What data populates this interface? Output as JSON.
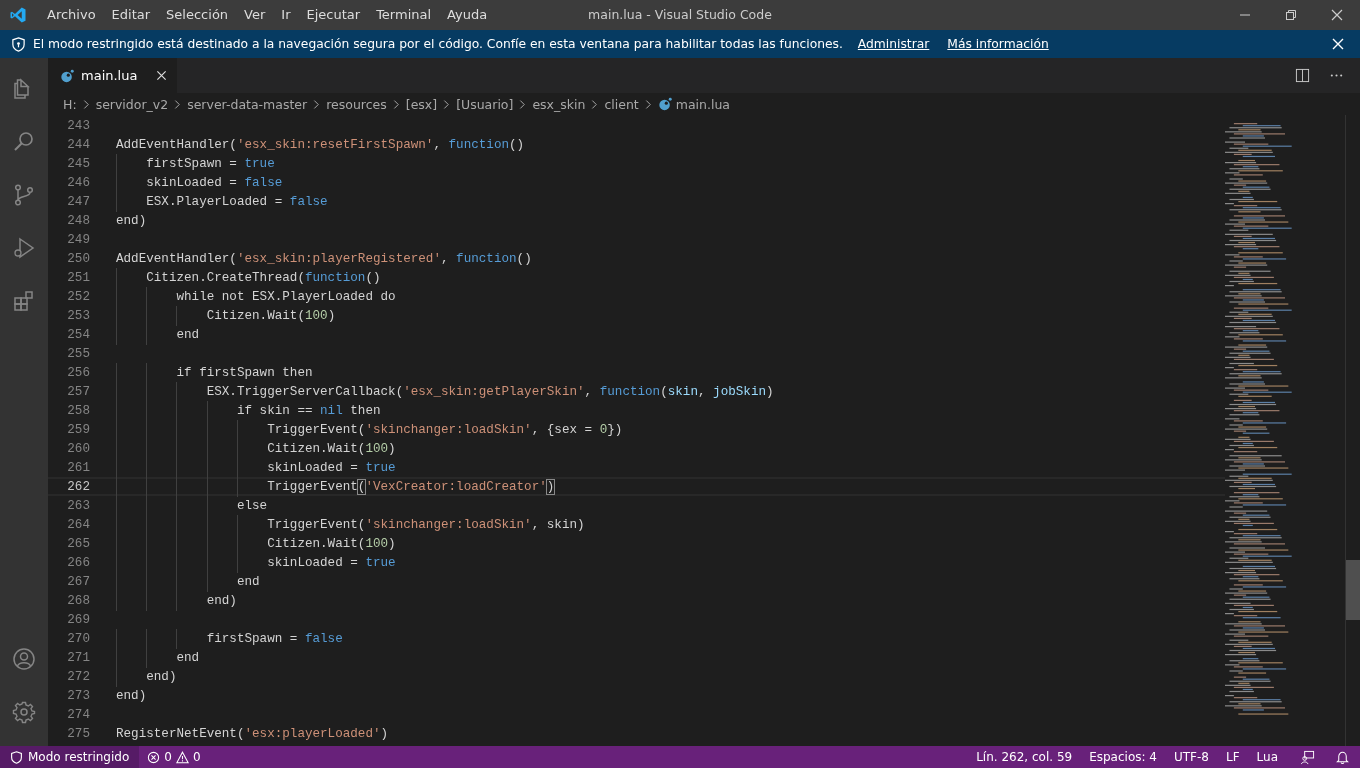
{
  "window": {
    "title": "main.lua - Visual Studio Code"
  },
  "menu": [
    "Archivo",
    "Editar",
    "Selección",
    "Ver",
    "Ir",
    "Ejecutar",
    "Terminal",
    "Ayuda"
  ],
  "banner": {
    "message": "El modo restringido está destinado a la navegación segura por el código. Confíe en esta ventana para habilitar todas las funciones.",
    "links": [
      "Administrar",
      "Más información"
    ]
  },
  "activity_bar": [
    {
      "kind": "files",
      "selected": false
    },
    {
      "kind": "search",
      "selected": false
    },
    {
      "kind": "source-control",
      "selected": false
    },
    {
      "kind": "debug",
      "selected": false
    },
    {
      "kind": "extensions",
      "selected": false
    }
  ],
  "activity_bar_bottom": [
    {
      "kind": "account"
    },
    {
      "kind": "settings"
    }
  ],
  "tabs": [
    {
      "label": "main.lua",
      "selected": true
    }
  ],
  "breadcrumb": [
    "H:",
    "servidor_v2",
    "server-data-master",
    "resources",
    "[esx]",
    "[Usuario]",
    "esx_skin",
    "client",
    "main.lua"
  ],
  "editor": {
    "lines": [
      {
        "number": "243",
        "selected": false
      },
      {
        "number": "244",
        "selected": false,
        "tokens": [
          {
            "kind": "plain",
            "text": "AddEventHandler("
          },
          {
            "kind": "string",
            "text": "'esx_skin:resetFirstSpawn'"
          },
          {
            "kind": "plain",
            "text": ", "
          },
          {
            "kind": "keyword",
            "text": "function"
          },
          {
            "kind": "plain",
            "text": "()"
          }
        ]
      },
      {
        "number": "245",
        "selected": false,
        "tokens": [
          {
            "kind": "plain",
            "text": "    firstSpawn = "
          },
          {
            "kind": "keyword",
            "text": "true"
          }
        ]
      },
      {
        "number": "246",
        "selected": false,
        "tokens": [
          {
            "kind": "plain",
            "text": "    skinLoaded = "
          },
          {
            "kind": "keyword",
            "text": "false"
          }
        ]
      },
      {
        "number": "247",
        "selected": false,
        "tokens": [
          {
            "kind": "plain",
            "text": "    ESX.PlayerLoaded = "
          },
          {
            "kind": "keyword",
            "text": "false"
          }
        ]
      },
      {
        "number": "248",
        "selected": false,
        "tokens": [
          {
            "kind": "plain",
            "text": "end)"
          }
        ]
      },
      {
        "number": "249",
        "selected": false
      },
      {
        "number": "250",
        "selected": false,
        "tokens": [
          {
            "kind": "plain",
            "text": "AddEventHandler("
          },
          {
            "kind": "string",
            "text": "'esx_skin:playerRegistered'"
          },
          {
            "kind": "plain",
            "text": ", "
          },
          {
            "kind": "keyword",
            "text": "function"
          },
          {
            "kind": "plain",
            "text": "()"
          }
        ]
      },
      {
        "number": "251",
        "selected": false,
        "tokens": [
          {
            "kind": "plain",
            "text": "    Citizen.CreateThread("
          },
          {
            "kind": "keyword",
            "text": "function"
          },
          {
            "kind": "plain",
            "text": "()"
          }
        ]
      },
      {
        "number": "252",
        "selected": false,
        "tokens": [
          {
            "kind": "plain",
            "text": "        while not ESX.PlayerLoaded do"
          }
        ]
      },
      {
        "number": "253",
        "selected": false,
        "tokens": [
          {
            "kind": "plain",
            "text": "            Citizen.Wait("
          },
          {
            "kind": "number",
            "text": "100"
          },
          {
            "kind": "plain",
            "text": ")"
          }
        ]
      },
      {
        "number": "254",
        "selected": false,
        "tokens": [
          {
            "kind": "plain",
            "text": "        end"
          }
        ]
      },
      {
        "number": "255",
        "selected": false
      },
      {
        "number": "256",
        "selected": false,
        "tokens": [
          {
            "kind": "plain",
            "text": "        if firstSpawn then"
          }
        ]
      },
      {
        "number": "257",
        "selected": false,
        "tokens": [
          {
            "kind": "plain",
            "text": "            ESX.TriggerServerCallback("
          },
          {
            "kind": "string",
            "text": "'esx_skin:getPlayerSkin'"
          },
          {
            "kind": "plain",
            "text": ", "
          },
          {
            "kind": "keyword",
            "text": "function"
          },
          {
            "kind": "plain",
            "text": "("
          },
          {
            "kind": "param",
            "text": "skin"
          },
          {
            "kind": "plain",
            "text": ", "
          },
          {
            "kind": "param",
            "text": "jobSkin"
          },
          {
            "kind": "plain",
            "text": ")"
          }
        ]
      },
      {
        "number": "258",
        "selected": false,
        "tokens": [
          {
            "kind": "plain",
            "text": "                if skin == "
          },
          {
            "kind": "keyword",
            "text": "nil"
          },
          {
            "kind": "plain",
            "text": " then"
          }
        ]
      },
      {
        "number": "259",
        "selected": false,
        "tokens": [
          {
            "kind": "plain",
            "text": "                    TriggerEvent("
          },
          {
            "kind": "string",
            "text": "'skinchanger:loadSkin'"
          },
          {
            "kind": "plain",
            "text": ", {sex = "
          },
          {
            "kind": "number",
            "text": "0"
          },
          {
            "kind": "plain",
            "text": "})"
          }
        ]
      },
      {
        "number": "260",
        "selected": false,
        "tokens": [
          {
            "kind": "plain",
            "text": "                    Citizen.Wait("
          },
          {
            "kind": "number",
            "text": "100"
          },
          {
            "kind": "plain",
            "text": ")"
          }
        ]
      },
      {
        "number": "261",
        "selected": false,
        "tokens": [
          {
            "kind": "plain",
            "text": "                    skinLoaded = "
          },
          {
            "kind": "keyword",
            "text": "true"
          }
        ]
      },
      {
        "number": "262",
        "selected": true,
        "tokens": [
          {
            "kind": "plain",
            "text": "                    TriggerEvent"
          },
          {
            "kind": "bracket",
            "text": "("
          },
          {
            "kind": "string",
            "text": "'VexCreator:loadCreator'"
          },
          {
            "kind": "bracket",
            "text": ")"
          }
        ]
      },
      {
        "number": "263",
        "selected": false,
        "tokens": [
          {
            "kind": "plain",
            "text": "                else"
          }
        ]
      },
      {
        "number": "264",
        "selected": false,
        "tokens": [
          {
            "kind": "plain",
            "text": "                    TriggerEvent("
          },
          {
            "kind": "string",
            "text": "'skinchanger:loadSkin'"
          },
          {
            "kind": "plain",
            "text": ", skin)"
          }
        ]
      },
      {
        "number": "265",
        "selected": false,
        "tokens": [
          {
            "kind": "plain",
            "text": "                    Citizen.Wait("
          },
          {
            "kind": "number",
            "text": "100"
          },
          {
            "kind": "plain",
            "text": ")"
          }
        ]
      },
      {
        "number": "266",
        "selected": false,
        "tokens": [
          {
            "kind": "plain",
            "text": "                    skinLoaded = "
          },
          {
            "kind": "keyword",
            "text": "true"
          }
        ]
      },
      {
        "number": "267",
        "selected": false,
        "tokens": [
          {
            "kind": "plain",
            "text": "                end"
          }
        ]
      },
      {
        "number": "268",
        "selected": false,
        "tokens": [
          {
            "kind": "plain",
            "text": "            end)"
          }
        ]
      },
      {
        "number": "269",
        "selected": false
      },
      {
        "number": "270",
        "selected": false,
        "tokens": [
          {
            "kind": "plain",
            "text": "            firstSpawn = "
          },
          {
            "kind": "keyword",
            "text": "false"
          }
        ]
      },
      {
        "number": "271",
        "selected": false,
        "tokens": [
          {
            "kind": "plain",
            "text": "        end"
          }
        ]
      },
      {
        "number": "272",
        "selected": false,
        "tokens": [
          {
            "kind": "plain",
            "text": "    end)"
          }
        ]
      },
      {
        "number": "273",
        "selected": false,
        "tokens": [
          {
            "kind": "plain",
            "text": "end)"
          }
        ]
      },
      {
        "number": "274",
        "selected": false
      },
      {
        "number": "275",
        "selected": false,
        "tokens": [
          {
            "kind": "plain",
            "text": "RegisterNetEvent("
          },
          {
            "kind": "string",
            "text": "'esx:playerLoaded'"
          },
          {
            "kind": "plain",
            "text": ")"
          }
        ]
      }
    ]
  },
  "status_bar": {
    "mode": "Modo restringido",
    "errors": "0",
    "warnings": "0",
    "right": [
      "Lín. 262, col. 59",
      "Espacios: 4",
      "UTF-8",
      "LF",
      "Lua"
    ]
  }
}
